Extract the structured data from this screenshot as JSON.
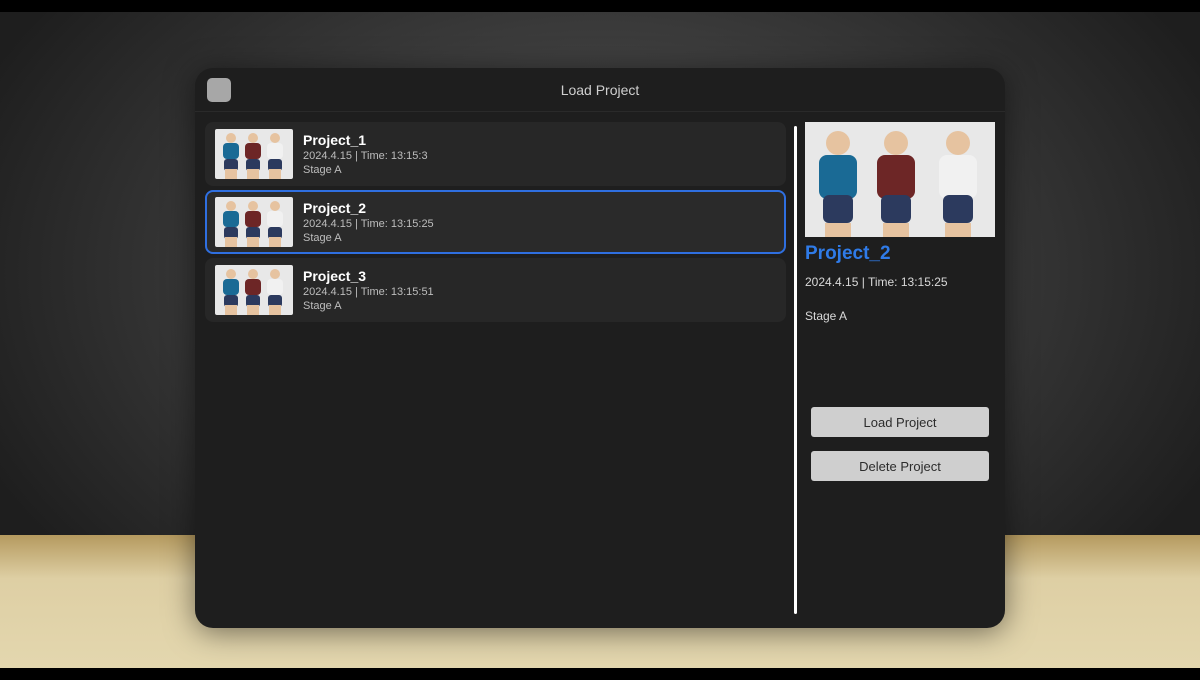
{
  "header": {
    "title": "Load Project"
  },
  "projects": [
    {
      "name": "Project_1",
      "timestamp": "2024.4.15 | Time: 13:15:3",
      "stage": "Stage A",
      "selected": false
    },
    {
      "name": "Project_2",
      "timestamp": "2024.4.15 | Time: 13:15:25",
      "stage": "Stage A",
      "selected": true
    },
    {
      "name": "Project_3",
      "timestamp": "2024.4.15 | Time: 13:15:51",
      "stage": "Stage A",
      "selected": false
    }
  ],
  "detail": {
    "name": "Project_2",
    "timestamp": "2024.4.15 | Time: 13:15:25",
    "stage": "Stage A",
    "load_label": "Load Project",
    "delete_label": "Delete Project"
  },
  "colors": {
    "accent": "#2f6fe0",
    "link": "#2f7be8",
    "panel_bg": "#1e1e1e",
    "row_bg": "#272727",
    "button_bg": "#cfcfcf"
  }
}
